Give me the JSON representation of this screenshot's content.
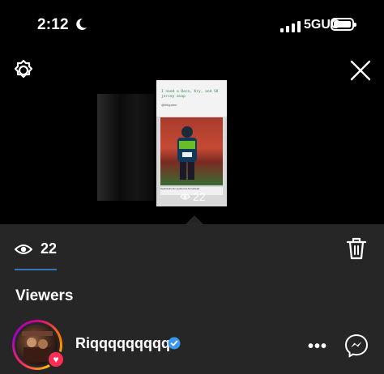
{
  "status_bar": {
    "time": "2:12",
    "network": "5GUC",
    "icons": [
      "moon-icon",
      "signal-icon",
      "battery-icon"
    ]
  },
  "header": {
    "left_icon": "settings-gear-icon",
    "right_icon": "close-icon"
  },
  "story": {
    "viewer_count": "22",
    "tweet_text": "I need a Deco, Kry, and SK jersey asap",
    "tweet_handle": "@hitqueen",
    "caption": "Seahawks fan spotted at Arrowhead"
  },
  "sheet": {
    "view_count": "22",
    "viewers_title": "Viewers",
    "viewers": [
      {
        "username": "Riqqqqqqqqq",
        "verified": true,
        "liked": true
      }
    ]
  },
  "colors": {
    "accent_blue": "#3a73b7",
    "verified_blue": "#3897f0",
    "like_red": "#ff2d55",
    "sheet_bg": "#262626"
  }
}
